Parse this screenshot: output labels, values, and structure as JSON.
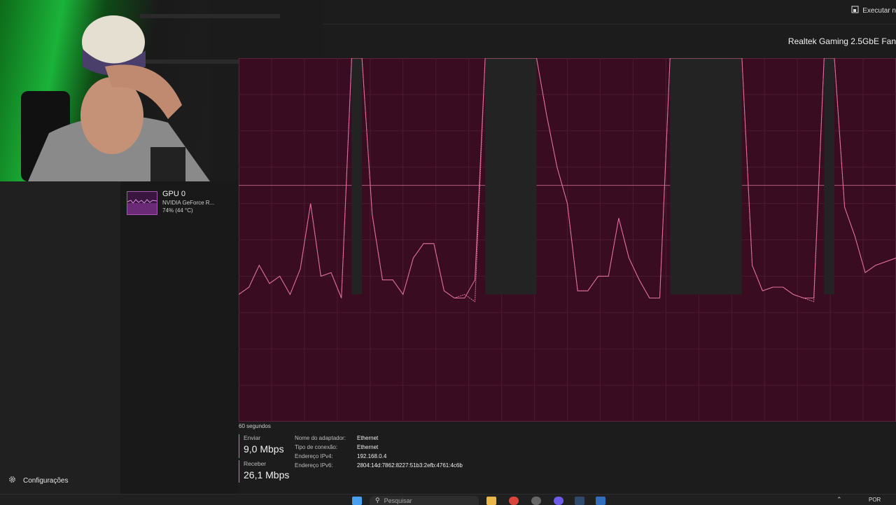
{
  "topbar": {
    "run_label": "Executar n",
    "run_icon": "run-task-icon"
  },
  "adapter_title": "Realtek Gaming 2.5GbE Fan",
  "sidebar": {
    "gpu": {
      "title": "GPU 0",
      "model": "NVIDIA GeForce R...",
      "usage": "74% (44 °C)"
    }
  },
  "graph": {
    "time_label": "60 segundos",
    "fill_color": "#3a0c22",
    "line_color": "#e0709f",
    "chart_data": {
      "type": "line",
      "xlabel": "60 segundos",
      "xlim": [
        60,
        0
      ],
      "ylim": [
        0,
        100
      ],
      "grid": true,
      "series": [
        {
          "name": "Enviar",
          "values": [
            35,
            37,
            43,
            38,
            40,
            35,
            42,
            60,
            40,
            41,
            34,
            100,
            100,
            57,
            39,
            39,
            35,
            45,
            49,
            49,
            36,
            34,
            34,
            39,
            100,
            100,
            100,
            100,
            100,
            100,
            84,
            70,
            60,
            36,
            36,
            40,
            40,
            56,
            45,
            39,
            34,
            34,
            100,
            100,
            100,
            100,
            100,
            100,
            100,
            100,
            43,
            36,
            37,
            37,
            35,
            34,
            34,
            100,
            100,
            59,
            51,
            41,
            43,
            44,
            45
          ]
        },
        {
          "name": "Receber",
          "values": [
            35,
            37,
            43,
            38,
            40,
            35,
            42,
            60,
            40,
            41,
            34,
            100,
            100,
            57,
            39,
            39,
            35,
            45,
            49,
            49,
            36,
            34,
            35,
            33,
            100,
            100,
            100,
            100,
            100,
            100,
            84,
            70,
            60,
            36,
            36,
            40,
            40,
            56,
            45,
            39,
            34,
            34,
            100,
            100,
            100,
            100,
            100,
            100,
            100,
            100,
            43,
            36,
            37,
            37,
            35,
            34,
            33,
            100,
            100,
            59,
            51,
            41,
            43,
            44,
            45
          ]
        }
      ]
    }
  },
  "stats": {
    "send": {
      "label": "Enviar",
      "value": "9,0 Mbps"
    },
    "receive": {
      "label": "Receber",
      "value": "26,1 Mbps"
    }
  },
  "props": [
    {
      "key": "Nome do adaptador:",
      "value": "Ethernet"
    },
    {
      "key": "Tipo de conexão:",
      "value": "Ethernet"
    },
    {
      "key": "Endereço IPv4:",
      "value": "192.168.0.4"
    },
    {
      "key": "Endereço IPv6:",
      "value": "2804:14d:7862:8227:51b3:2efb:4761:4c6b"
    }
  ],
  "settings_label": "Configurações",
  "taskbar": {
    "search_placeholder": "Pesquisar",
    "lang": "POR",
    "apps": [
      "file-explorer-icon",
      "chrome-icon",
      "app-icon",
      "discord-icon",
      "steam-icon",
      "task-manager-icon"
    ]
  },
  "webcam_alt": ""
}
